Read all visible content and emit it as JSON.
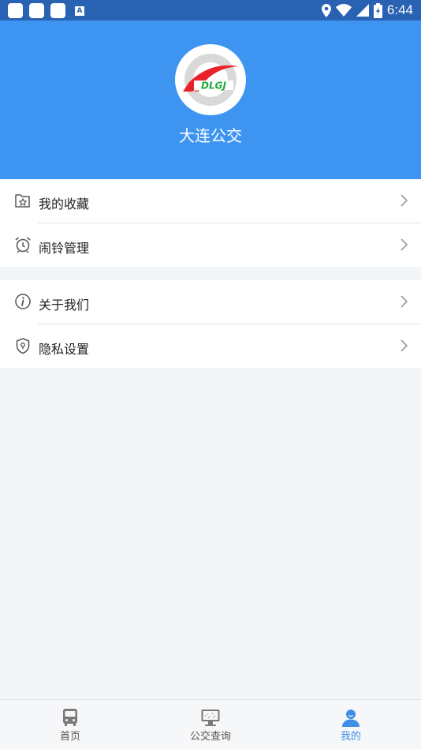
{
  "status_bar": {
    "time": "6:44",
    "notif_letter": "A"
  },
  "profile": {
    "app_name": "大连公交",
    "logo_text": "DLGJ"
  },
  "menu": {
    "group1": [
      {
        "label": "我的收藏",
        "icon": "favorites-icon"
      },
      {
        "label": "闹铃管理",
        "icon": "alarm-clock-icon"
      }
    ],
    "group2": [
      {
        "label": "关于我们",
        "icon": "info-icon"
      },
      {
        "label": "隐私设置",
        "icon": "privacy-shield-icon"
      }
    ]
  },
  "tabs": [
    {
      "label": "首页",
      "icon": "bus-icon",
      "active": false
    },
    {
      "label": "公交查询",
      "icon": "monitor-icon",
      "active": false
    },
    {
      "label": "我的",
      "icon": "user-icon",
      "active": true
    }
  ],
  "colors": {
    "header": "#3e95f1",
    "status_bar": "#2962b2",
    "tab_active": "#3e8fe6"
  }
}
